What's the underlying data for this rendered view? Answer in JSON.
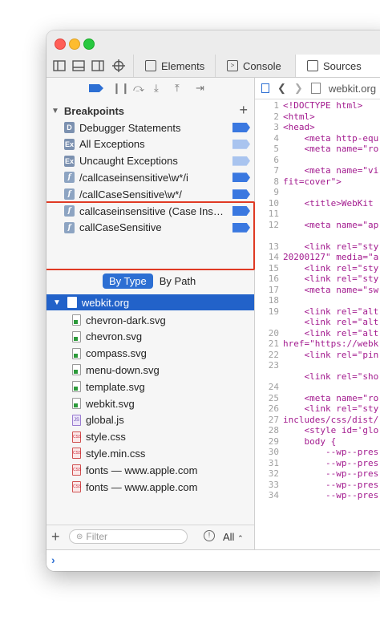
{
  "tabs": {
    "elements": "Elements",
    "console": "Console",
    "sources": "Sources"
  },
  "breakpoints": {
    "section_title": "Breakpoints",
    "items": [
      {
        "icon": "D",
        "label": "Debugger Statements",
        "flag_color": "#3a78e0"
      },
      {
        "icon": "Ex",
        "label": "All Exceptions",
        "flag_color": "#a9c4ef"
      },
      {
        "icon": "Ex",
        "label": "Uncaught Exceptions",
        "flag_color": "#a9c4ef"
      },
      {
        "icon": "f",
        "label": "/callcaseinsensitive\\w*/i",
        "flag_color": "#3a78e0"
      },
      {
        "icon": "f",
        "label": "/callCaseSensitive\\w*/",
        "flag_color": "#3a78e0"
      },
      {
        "icon": "f",
        "label": "callcaseinsensitive (Case Insensitive)",
        "flag_color": "#3a78e0"
      },
      {
        "icon": "f",
        "label": "callCaseSensitive",
        "flag_color": "#3a78e0"
      }
    ]
  },
  "group_toggle": {
    "by_type": "By Type",
    "by_path": "By Path"
  },
  "tree": {
    "root": "webkit.org",
    "files": [
      {
        "name": "chevron-dark.svg",
        "type": "svg"
      },
      {
        "name": "chevron.svg",
        "type": "svg"
      },
      {
        "name": "compass.svg",
        "type": "svg"
      },
      {
        "name": "menu-down.svg",
        "type": "svg"
      },
      {
        "name": "template.svg",
        "type": "svg"
      },
      {
        "name": "webkit.svg",
        "type": "svg"
      },
      {
        "name": "global.js",
        "type": "js"
      },
      {
        "name": "style.css",
        "type": "css"
      },
      {
        "name": "style.min.css",
        "type": "css"
      },
      {
        "name": "fonts — www.apple.com",
        "type": "css"
      },
      {
        "name": "fonts — www.apple.com",
        "type": "css"
      }
    ]
  },
  "filter": {
    "placeholder": "Filter",
    "scope": "All"
  },
  "editor": {
    "file_name": "webkit.org",
    "line_numbers": [
      "1",
      "2",
      "3",
      "4",
      "5",
      "6",
      "7",
      "8",
      "9",
      "10",
      "11",
      "12",
      "",
      "13",
      "14",
      "15",
      "16",
      "17",
      "18",
      "19",
      "",
      "20",
      "21",
      "22",
      "23",
      "",
      "24",
      "25",
      "26",
      "27",
      "28",
      "29",
      "30",
      "31",
      "32",
      "33",
      "34"
    ],
    "code_lines": [
      "<!DOCTYPE html>",
      "<html>",
      "<head>",
      "    <meta http-equ",
      "    <meta name=\"ro",
      "",
      "    <meta name=\"vi",
      "fit=cover\">",
      "",
      "    <title>WebKit",
      "",
      "    <meta name=\"ap",
      "",
      "    <link rel=\"sty",
      "20200127\" media=\"a",
      "    <link rel=\"sty",
      "    <link rel=\"sty",
      "    <meta name=\"sw",
      "",
      "    <link rel=\"alt",
      "    <link rel=\"alt",
      "    <link rel=\"alt",
      "href=\"https://webk",
      "    <link rel=\"pin",
      "",
      "    <link rel=\"sho",
      "",
      "    <meta name=\"ro",
      "    <link rel=\"sty",
      "includes/css/dist/",
      "    <style id='glo",
      "    body {",
      "        --wp--pres",
      "        --wp--pres",
      "        --wp--pres",
      "        --wp--pres",
      "        --wp--pres"
    ]
  }
}
